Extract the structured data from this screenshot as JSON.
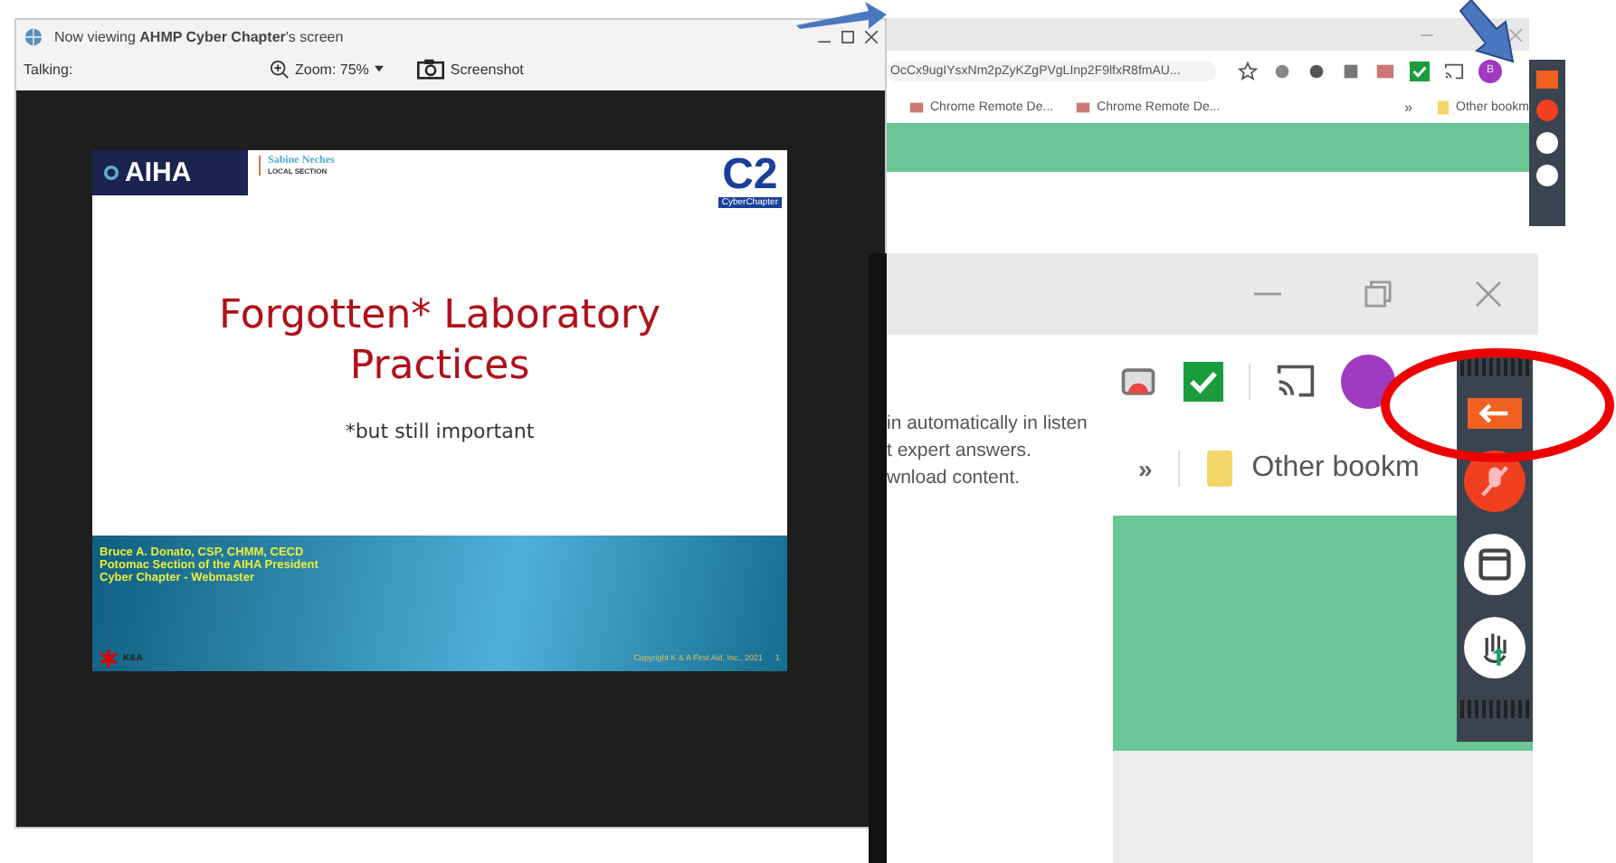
{
  "viewer": {
    "title": "Now viewing **AHMP Cyber Chapter**'s screen",
    "talking": "Talking:",
    "zoom": "Zoom: 75%",
    "screenshot": "Screenshot",
    "slide": {
      "logo": "AIHA",
      "section_name": "Sabine Neches",
      "section_sub": "LOCAL SECTION",
      "badge": "C2",
      "badge_sub": "CyberChapter",
      "title": "Forgotten* Laboratory Practices",
      "subtitle": "*but still important",
      "presenter": [
        "Bruce A. Donato, CSP, CHMM, CECD",
        "Potomac Section of the AIHA  President",
        "Cyber Chapter - Webmaster"
      ],
      "footer_logo": "K&A",
      "copyright": "Copyright K & A First Aid, Inc., 2021",
      "page": "1"
    }
  },
  "browser": {
    "url": "OcCx9ugIYsxNm2pZyKZgPVgLInp2F9lfxR8fmAU...",
    "avatar": "B",
    "bookmarks": [
      "Chrome Remote De...",
      "Chrome Remote De..."
    ],
    "more": "»",
    "other": "Other bookm"
  },
  "zoomed": {
    "lines": [
      "in automatically in listen",
      "t expert answers.",
      "wnload content."
    ],
    "more": "»",
    "other": "Other bookm"
  }
}
